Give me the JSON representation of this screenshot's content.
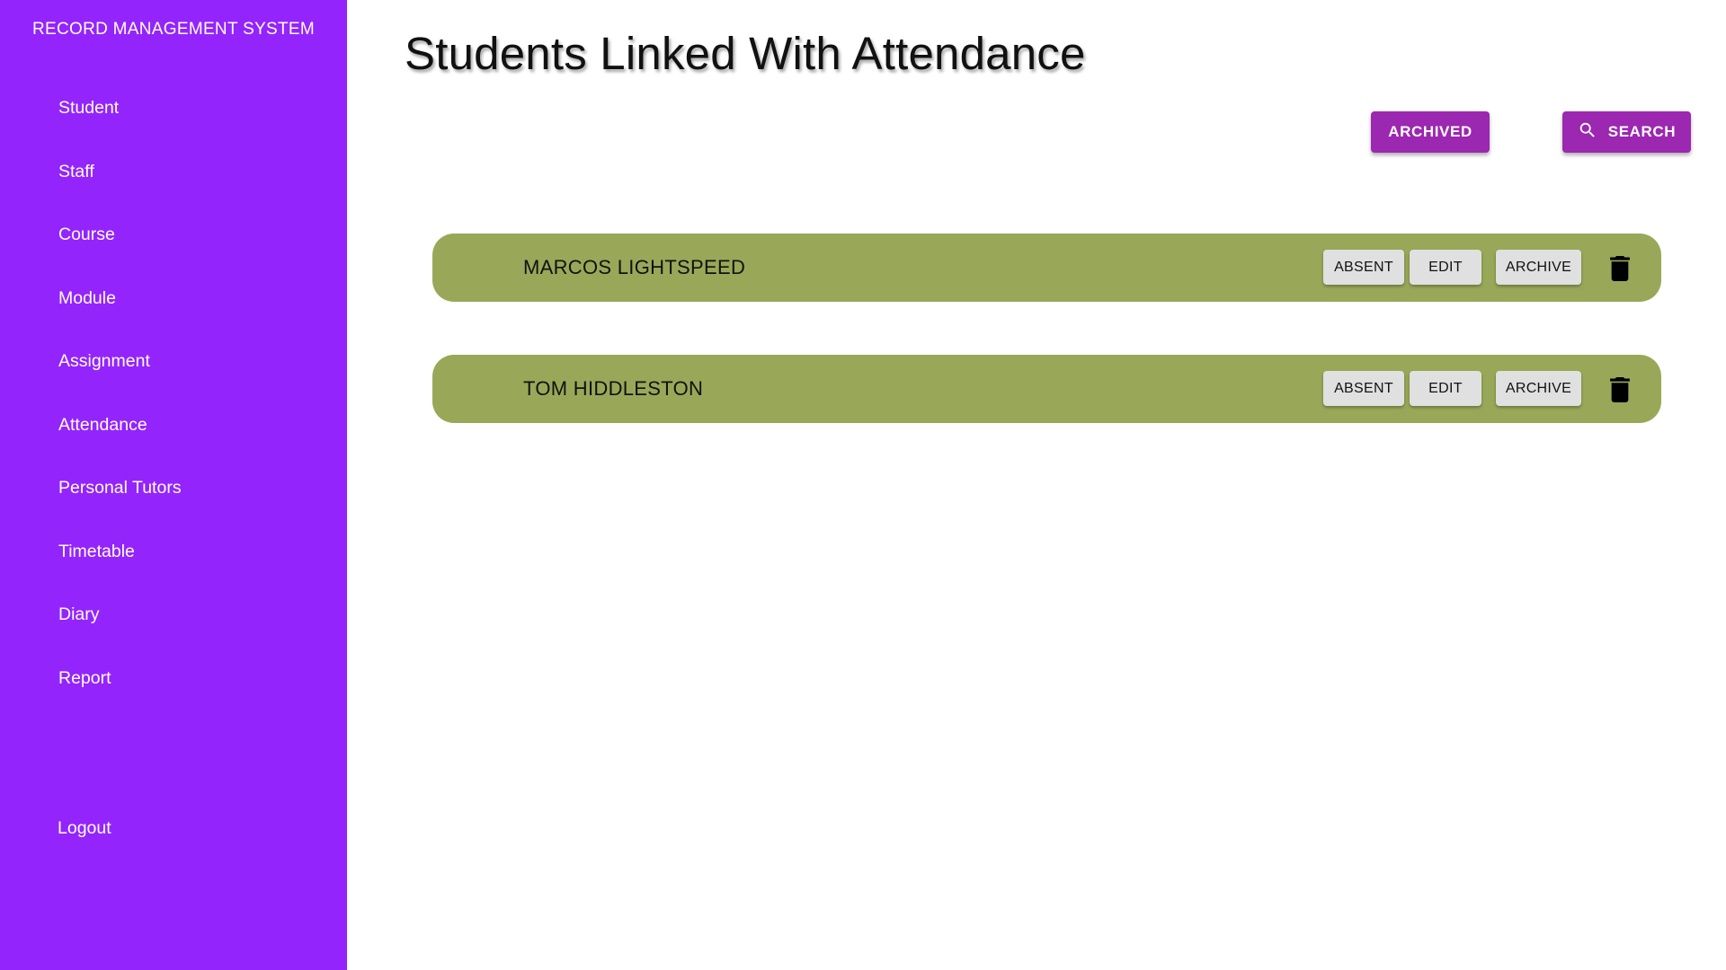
{
  "sidebar": {
    "brand": "RECORD MANAGEMENT SYSTEM",
    "items": [
      {
        "label": "Student"
      },
      {
        "label": "Staff"
      },
      {
        "label": "Course"
      },
      {
        "label": "Module"
      },
      {
        "label": "Assignment"
      },
      {
        "label": "Attendance"
      },
      {
        "label": "Personal Tutors"
      },
      {
        "label": "Timetable"
      },
      {
        "label": "Diary"
      },
      {
        "label": "Report"
      }
    ],
    "logout": "Logout"
  },
  "main": {
    "title": "Students Linked With Attendance",
    "archived_label": "ARCHIVED",
    "search_label": "SEARCH",
    "records": [
      {
        "name": "MARCOS LIGHTSPEED",
        "absent_label": "ABSENT",
        "edit_label": "EDIT",
        "archive_label": "ARCHIVE"
      },
      {
        "name": "TOM HIDDLESTON",
        "absent_label": "ABSENT",
        "edit_label": "EDIT",
        "archive_label": "ARCHIVE"
      }
    ]
  },
  "colors": {
    "sidebar": "#9424fc",
    "primary_button": "#9c27b0",
    "record_card": "#98a858",
    "secondary_button": "#e0e0e0"
  },
  "icons": {
    "search": "search-icon",
    "delete": "trash-icon"
  }
}
